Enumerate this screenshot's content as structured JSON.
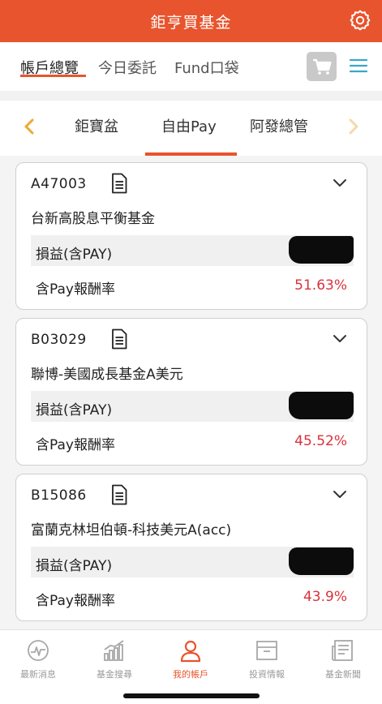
{
  "header": {
    "title": "鉅亨買基金",
    "icon": "gear-icon"
  },
  "topnav": {
    "tabs": [
      {
        "label": "帳戶總覽",
        "active": true
      },
      {
        "label": "今日委託",
        "active": false
      },
      {
        "label": "Fund口袋",
        "active": false
      }
    ],
    "icons": [
      "cart-icon",
      "hamburger-menu-icon"
    ]
  },
  "subnav": {
    "items": [
      {
        "label": "鉅寶盆",
        "active": false
      },
      {
        "label": "自由Pay",
        "active": true
      },
      {
        "label": "阿發總管",
        "active": false
      }
    ]
  },
  "funds": [
    {
      "code": "A47003",
      "name": "台新高股息平衡基金",
      "pl_label": "損益(含PAY)",
      "return_label": "含Pay報酬率",
      "return_value": "51.63%"
    },
    {
      "code": "B03029",
      "name": "聯博-美國成長基金A美元",
      "pl_label": "損益(含PAY)",
      "return_label": "含Pay報酬率",
      "return_value": "45.52%"
    },
    {
      "code": "B15086",
      "name": "富蘭克林坦伯頓-科技美元A(acc)",
      "pl_label": "損益(含PAY)",
      "return_label": "含Pay報酬率",
      "return_value": "43.9%"
    }
  ],
  "bottom_nav": {
    "items": [
      {
        "label": "最新消息",
        "icon": "news-pulse-icon",
        "active": false
      },
      {
        "label": "基金搜尋",
        "icon": "bar-chart-icon",
        "active": false
      },
      {
        "label": "我的帳戶",
        "icon": "user-icon",
        "active": true
      },
      {
        "label": "投資情報",
        "icon": "inbox-icon",
        "active": false
      },
      {
        "label": "基金新聞",
        "icon": "newspaper-icon",
        "active": false
      }
    ]
  },
  "colors": {
    "brand": "#e8542d",
    "positive_return": "#d9323c",
    "inactive": "#9a9a9a"
  }
}
